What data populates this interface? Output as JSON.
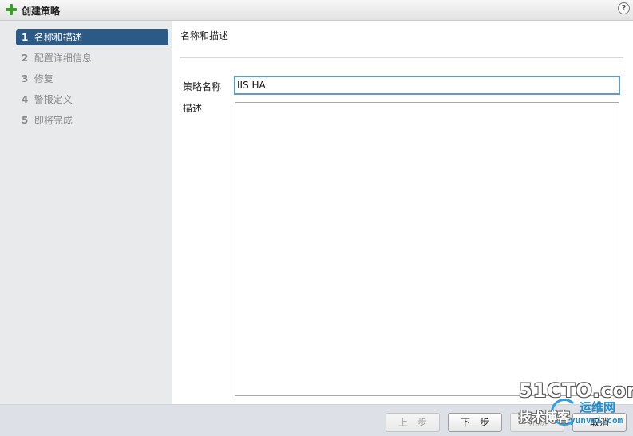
{
  "window": {
    "title": "创建策略",
    "help_label": "?"
  },
  "sidebar": {
    "steps": [
      {
        "num": "1",
        "label": "名称和描述"
      },
      {
        "num": "2",
        "label": "配置详细信息"
      },
      {
        "num": "3",
        "label": "修复"
      },
      {
        "num": "4",
        "label": "警报定义"
      },
      {
        "num": "5",
        "label": "即将完成"
      }
    ]
  },
  "main": {
    "section_title": "名称和描述",
    "name_label": "策略名称",
    "name_value": "IIS HA",
    "description_label": "描述",
    "description_value": ""
  },
  "footer": {
    "back_label": "上一步",
    "next_label": "下一步",
    "finish_label": "完成",
    "cancel_label": "取消"
  },
  "watermark": {
    "brand": "51CTO.com",
    "blog": "技术博客",
    "site_cn": "运维网",
    "site_domain": "yunvei.com"
  },
  "colors": {
    "active_step": "#2b5a86",
    "plus_icon": "#3f9b2b",
    "input_focus": "#5b9ec9"
  }
}
